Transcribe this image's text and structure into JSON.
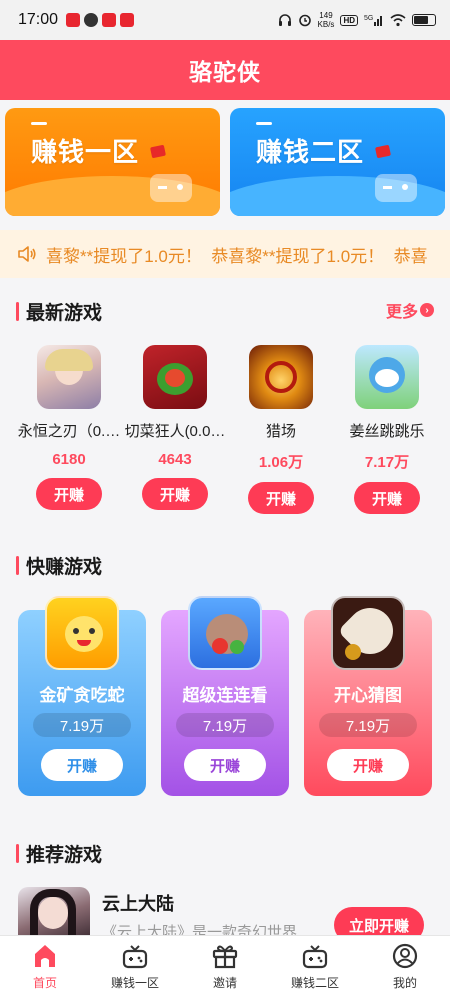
{
  "status_bar": {
    "time": "17:00",
    "net_speed": "149\nKB/s",
    "hd": "HD",
    "signal": "5G"
  },
  "header": {
    "title": "骆驼侠"
  },
  "zones": [
    {
      "title": "赚钱一区",
      "color": "#ff8a0a"
    },
    {
      "title": "赚钱二区",
      "color": "#1f95fb"
    }
  ],
  "marquee": {
    "text": "喜黎**提现了1.0元！  恭喜黎**提现了1.0元！  恭喜"
  },
  "new_games": {
    "title": "最新游戏",
    "more_label": "更多",
    "items": [
      {
        "name": "永恒之刃（0.…",
        "count": "6180",
        "button": "开赚"
      },
      {
        "name": "切菜狂人(0.0…",
        "count": "4643",
        "button": "开赚"
      },
      {
        "name": "猎场",
        "count": "1.06万",
        "button": "开赚"
      },
      {
        "name": "姜丝跳跳乐",
        "count": "7.17万",
        "button": "开赚"
      }
    ]
  },
  "quick_games": {
    "title": "快赚游戏",
    "items": [
      {
        "name": "金矿贪吃蛇",
        "count": "7.19万",
        "button": "开赚"
      },
      {
        "name": "超级连连看",
        "count": "7.19万",
        "button": "开赚"
      },
      {
        "name": "开心猜图",
        "count": "7.19万",
        "button": "开赚"
      }
    ]
  },
  "recommended": {
    "title": "推荐游戏",
    "item": {
      "name": "云上大陆",
      "desc": "《云上大陆》是一款奇幻世界…",
      "button": "立即开赚"
    }
  },
  "tabbar": {
    "items": [
      {
        "label": "首页",
        "icon": "home-icon",
        "active": true
      },
      {
        "label": "赚钱一区",
        "icon": "gamepad-icon"
      },
      {
        "label": "邀请",
        "icon": "gift-icon"
      },
      {
        "label": "赚钱二区",
        "icon": "gamepad-icon"
      },
      {
        "label": "我的",
        "icon": "user-icon"
      }
    ]
  },
  "colors": {
    "accent": "#fe4a5e",
    "orange": "#ff8a0a",
    "blue": "#1f95fb"
  }
}
